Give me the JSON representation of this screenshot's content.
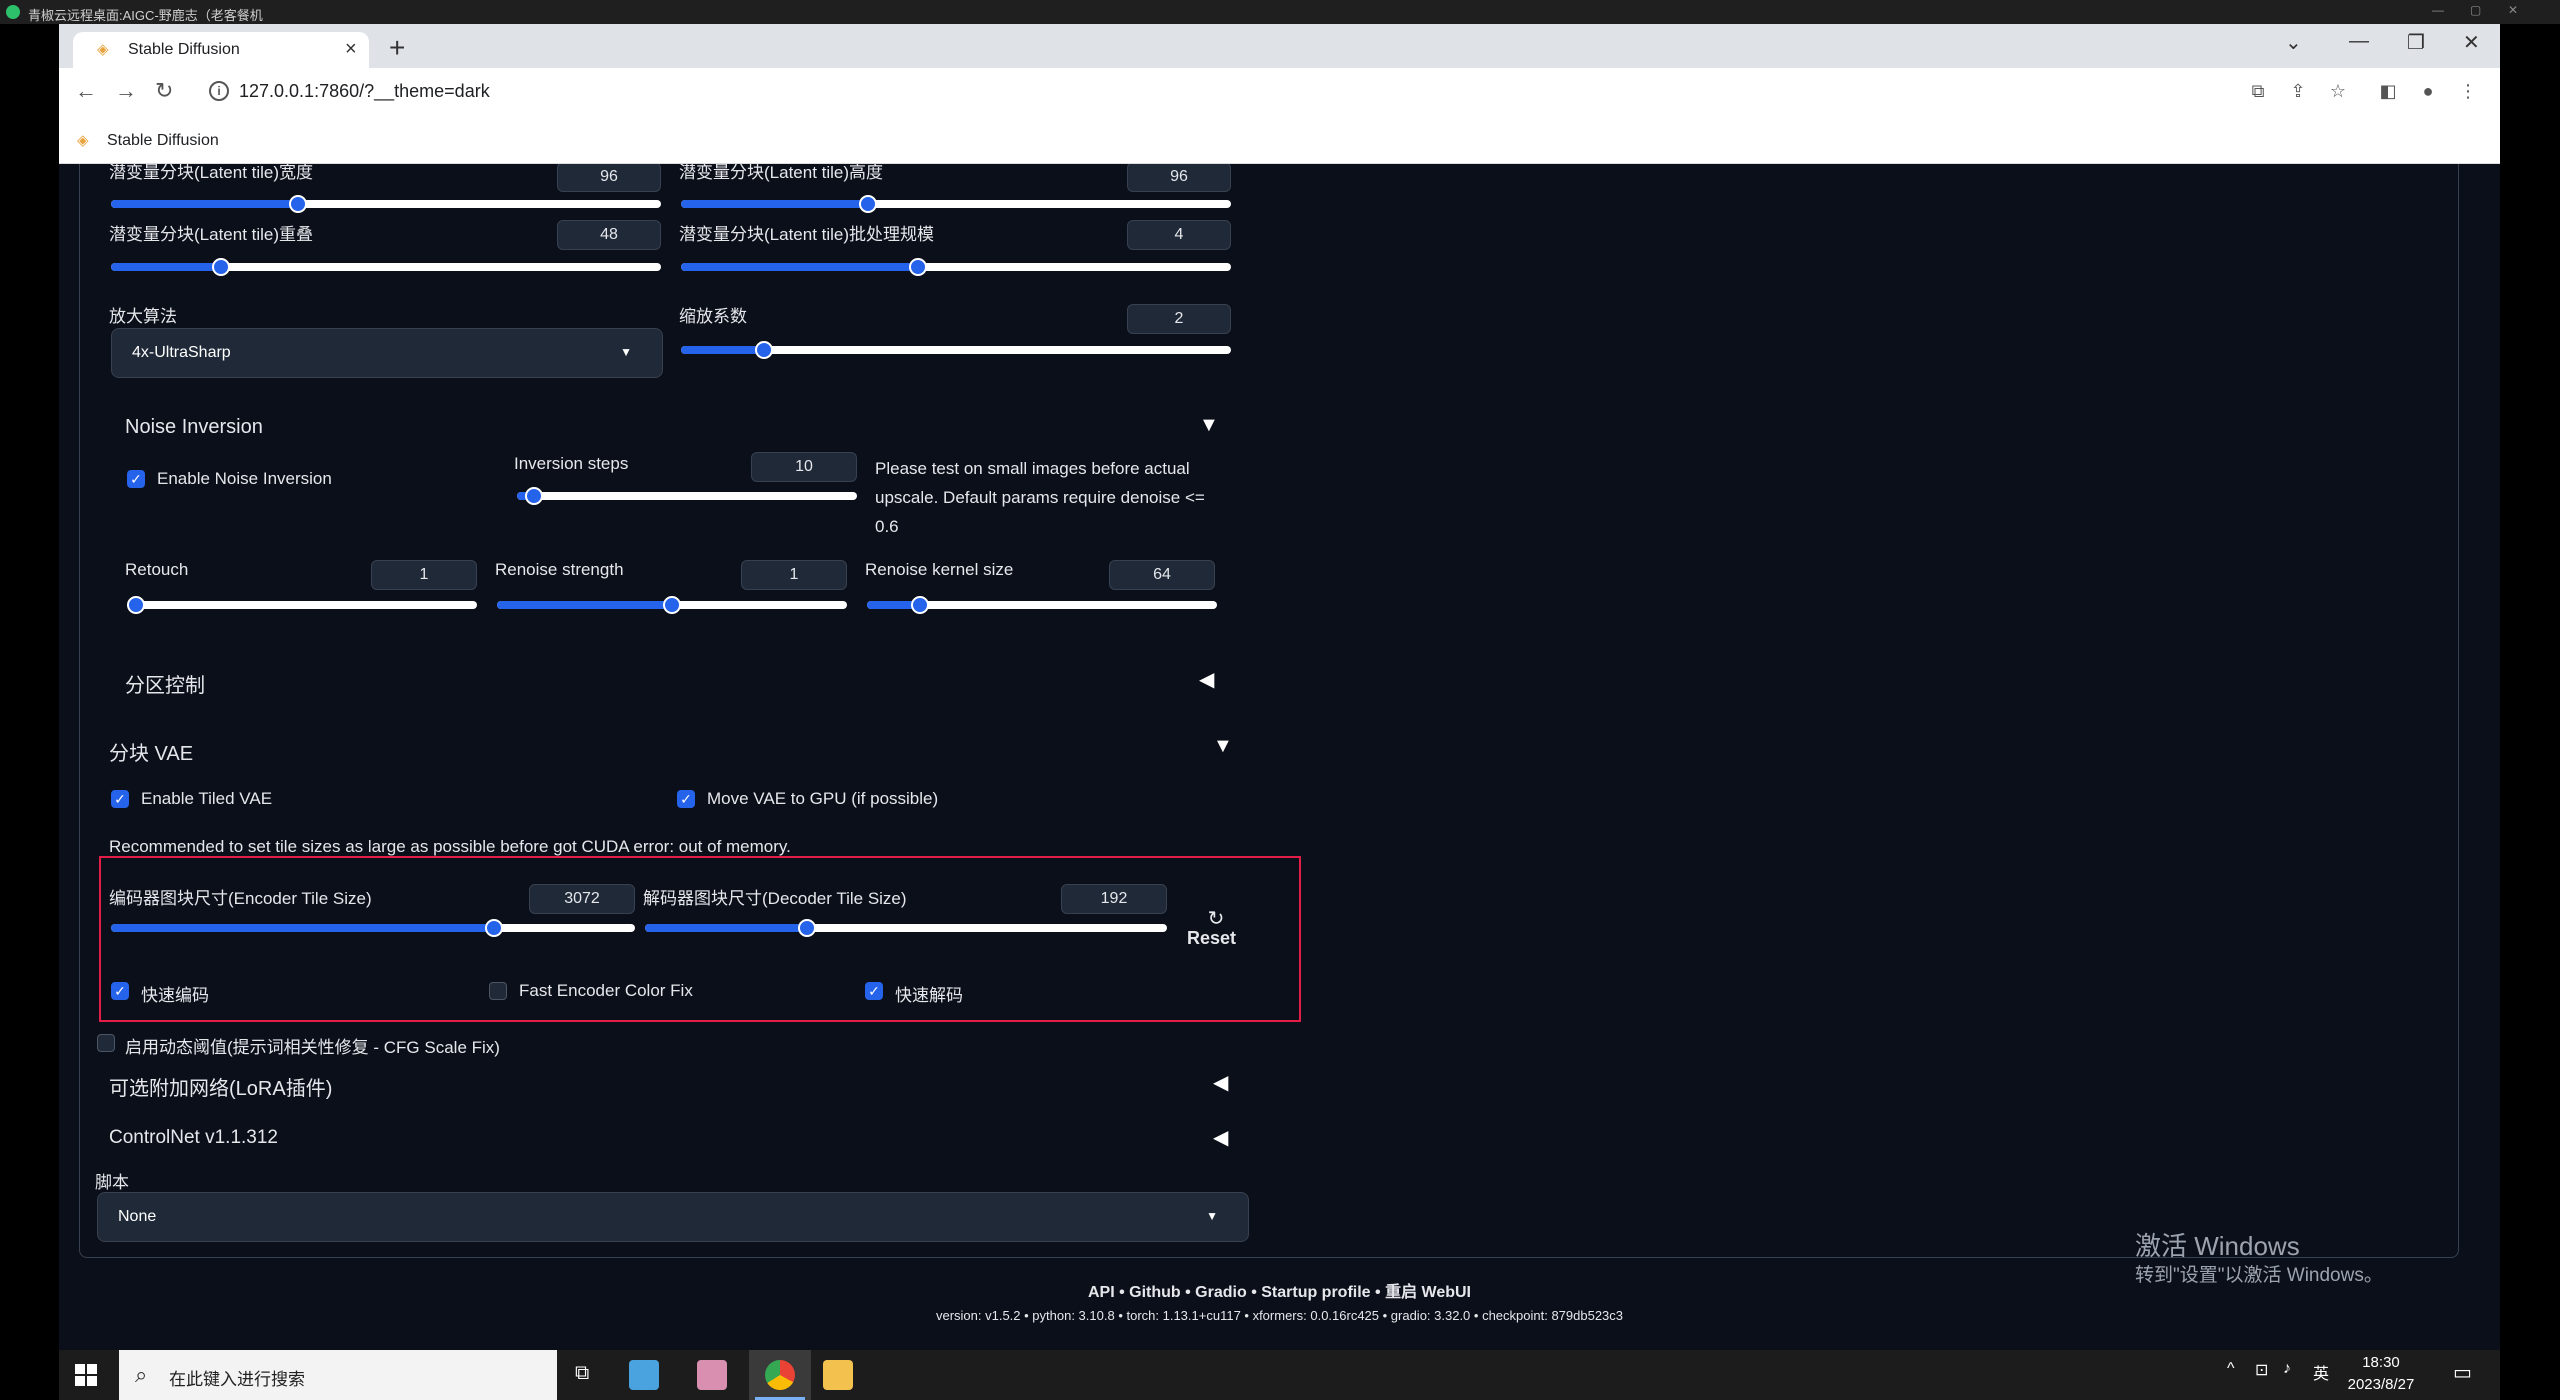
{
  "remote_bar": {
    "title": "青椒云远程桌面:AIGC-野鹿志（老客餐机"
  },
  "browser": {
    "tab_title": "Stable Diffusion",
    "url": "127.0.0.1:7860/?__theme=dark",
    "bookmark": "Stable Diffusion"
  },
  "tiled_diffusion": {
    "tile_width_label": "潜变量分块(Latent tile)宽度",
    "tile_width_value": "96",
    "tile_width_frac": 0.34,
    "tile_height_label": "潜变量分块(Latent tile)高度",
    "tile_height_value": "96",
    "tile_height_frac": 0.34,
    "overlap_label": "潜变量分块(Latent tile)重叠",
    "overlap_value": "48",
    "overlap_frac": 0.2,
    "batch_label": "潜变量分块(Latent tile)批处理规模",
    "batch_value": "4",
    "batch_frac": 0.43,
    "upscaler_label": "放大算法",
    "upscaler_value": "4x-UltraSharp",
    "scale_label": "缩放系数",
    "scale_value": "2",
    "scale_frac": 0.15
  },
  "noise_inversion": {
    "title": "Noise Inversion",
    "enable_label": "Enable Noise Inversion",
    "enable_checked": true,
    "steps_label": "Inversion steps",
    "steps_value": "10",
    "steps_frac": 0.05,
    "note": "Please test on small images before actual upscale. Default params require denoise <= 0.6",
    "retouch_label": "Retouch",
    "retouch_value": "1",
    "retouch_frac": 0.0,
    "renoise_strength_label": "Renoise strength",
    "renoise_strength_value": "1",
    "renoise_strength_frac": 0.5,
    "renoise_kernel_label": "Renoise kernel size",
    "renoise_kernel_value": "64",
    "renoise_kernel_frac": 0.15
  },
  "region_control": {
    "title": "分区控制"
  },
  "tiled_vae": {
    "title": "分块 VAE",
    "enable_label": "Enable Tiled VAE",
    "enable_checked": true,
    "move_gpu_label": "Move VAE to GPU (if possible)",
    "move_gpu_checked": true,
    "note": "Recommended to set tile sizes as large as possible before got CUDA error: out of memory.",
    "encoder_label": "编码器图块尺寸(Encoder Tile Size)",
    "encoder_value": "3072",
    "encoder_frac": 0.73,
    "decoder_label": "解码器图块尺寸(Decoder Tile Size)",
    "decoder_value": "192",
    "decoder_frac": 0.31,
    "reset_label": "Reset",
    "fast_encoder_label": "快速编码",
    "fast_encoder_checked": true,
    "fast_color_fix_label": "Fast Encoder Color Fix",
    "fast_color_fix_checked": false,
    "fast_decoder_label": "快速解码",
    "fast_decoder_checked": true
  },
  "cfg_fix_label": "启用动态阈值(提示词相关性修复 - CFG Scale Fix)",
  "lora_title": "可选附加网络(LoRA插件)",
  "controlnet_title": "ControlNet v1.1.312",
  "script": {
    "label": "脚本",
    "value": "None"
  },
  "footer": {
    "links": "API  •  Github  •  Gradio  •  Startup profile  •  重启 WebUI",
    "versions": "version: v1.5.2  •  python: 3.10.8  •  torch: 1.13.1+cu117  •  xformers: 0.0.16rc425  •  gradio: 3.32.0  •  checkpoint: 879db523c3"
  },
  "watermark": {
    "line1": "激活 Windows",
    "line2": "转到\"设置\"以激活 Windows。"
  },
  "taskbar": {
    "search_placeholder": "在此键入进行搜索",
    "time": "18:30",
    "date": "2023/8/27",
    "ime": "英"
  },
  "colors": {
    "accent": "#2563eb",
    "page_bg": "#0b0f19",
    "highlight_box": "#e11d48"
  }
}
